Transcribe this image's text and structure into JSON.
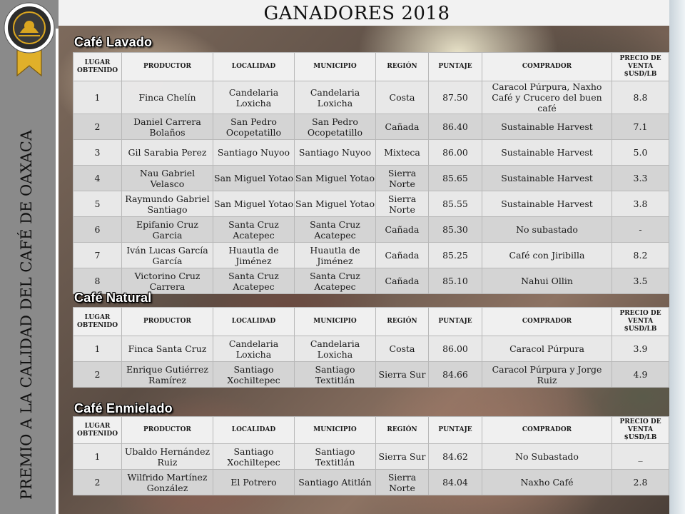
{
  "page_title": "GANADORES 2018",
  "vertical_title": "PREMIO A LA CALIDAD DEL CAFÉ DE OAXACA",
  "seal_text": "PREMIO A LA CALIDAD DEL CAFÉ DE OAXACA",
  "headers": [
    "LUGAR OBTENIDO",
    "PRODUCTOR",
    "LOCALIDAD",
    "MUNICIPIO",
    "REGIÓN",
    "PUNTAJE",
    "COMPRADOR",
    "PRECIO DE VENTA $USD/LB"
  ],
  "colors": {
    "sidebar": "#8a8a8a",
    "label_text": "#ffffff",
    "seal_gold": "#d9a520"
  },
  "sections": [
    {
      "label": "Café Lavado",
      "rows": [
        [
          "1",
          "Finca Chelín",
          "Candelaria Loxicha",
          "Candelaria Loxicha",
          "Costa",
          "87.50",
          "Caracol Púrpura, Naxho Café y Crucero del buen café",
          "8.8"
        ],
        [
          "2",
          "Daniel Carrera Bolaños",
          "San Pedro Ocopetatillo",
          "San Pedro Ocopetatillo",
          "Cañada",
          "86.40",
          "Sustainable Harvest",
          "7.1"
        ],
        [
          "3",
          "Gil Sarabia Perez",
          "Santiago Nuyoo",
          "Santiago Nuyoo",
          "Mixteca",
          "86.00",
          "Sustainable Harvest",
          "5.0"
        ],
        [
          "4",
          "Nau Gabriel Velasco",
          "San Miguel Yotao",
          "San Miguel Yotao",
          "Sierra Norte",
          "85.65",
          "Sustainable Harvest",
          "3.3"
        ],
        [
          "5",
          "Raymundo Gabriel Santiago",
          "San Miguel Yotao",
          "San Miguel Yotao",
          "Sierra Norte",
          "85.55",
          "Sustainable Harvest",
          "3.8"
        ],
        [
          "6",
          "Epifanio Cruz Garcia",
          "Santa Cruz Acatepec",
          "Santa Cruz Acatepec",
          "Cañada",
          "85.30",
          "No subastado",
          "-"
        ],
        [
          "7",
          "Iván Lucas García García",
          "Huautla de Jiménez",
          "Huautla de Jiménez",
          "Cañada",
          "85.25",
          "Café con Jiribilla",
          "8.2"
        ],
        [
          "8",
          "Victorino Cruz Carrera",
          "Santa Cruz Acatepec",
          "Santa Cruz Acatepec",
          "Cañada",
          "85.10",
          "Nahui Ollin",
          "3.5"
        ]
      ]
    },
    {
      "label": "Café Natural",
      "rows": [
        [
          "1",
          "Finca Santa Cruz",
          "Candelaria Loxicha",
          "Candelaria Loxicha",
          "Costa",
          "86.00",
          "Caracol Púrpura",
          "3.9"
        ],
        [
          "2",
          "Enrique Gutiérrez Ramírez",
          "Santiago Xochiltepec",
          "Santiago Textitlán",
          "Sierra Sur",
          "84.66",
          "Caracol Púrpura y Jorge Ruiz",
          "4.9"
        ]
      ]
    },
    {
      "label": "Café Enmielado",
      "rows": [
        [
          "1",
          "Ubaldo Hernández Ruiz",
          "Santiago Xochiltepec",
          "Santiago Textitlán",
          "Sierra Sur",
          "84.62",
          "No Subastado",
          "_"
        ],
        [
          "2",
          "Wilfrido Martínez González",
          "El Potrero",
          "Santiago Atitlán",
          "Sierra Norte",
          "84.04",
          "Naxho Café",
          "2.8"
        ]
      ]
    }
  ]
}
